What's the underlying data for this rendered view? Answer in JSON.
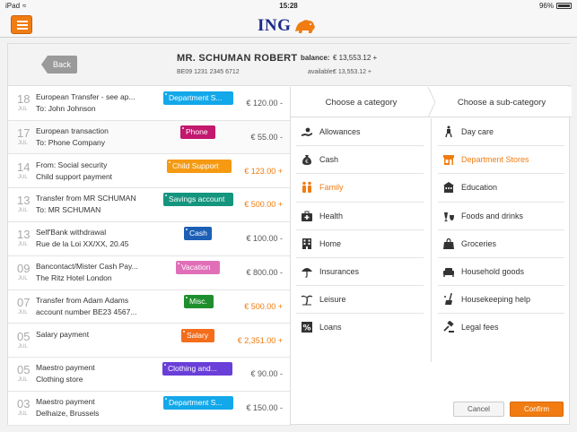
{
  "status": {
    "device": "iPad",
    "time": "15:28",
    "battery": "96%"
  },
  "brand": {
    "name": "ING",
    "accent": "#f07c12",
    "brand_blue": "#1a2a8a"
  },
  "header": {
    "back_label": "Back",
    "owner": "MR. SCHUMAN ROBERT",
    "iban": "BE09 1231 2345 6712",
    "balance_label": "balance:",
    "balance_value": "€ 13,553.12 +",
    "available_label": "available:",
    "available_value": "€ 13,553.12 +"
  },
  "transactions": [
    {
      "day": "18",
      "month": "JUL",
      "line1": "European Transfer - see ap...",
      "line2": "To: John Johnson",
      "tag": "Department S...",
      "tag_color": "#13a8ea",
      "amount": "€ 120.00 -",
      "positive": false
    },
    {
      "day": "17",
      "month": "JUL",
      "line1": "European transaction",
      "line2": "To: Phone Company",
      "tag": "Phone",
      "tag_color": "#c2186e",
      "amount": "€ 55.00 -",
      "positive": false
    },
    {
      "day": "14",
      "month": "JUL",
      "line1": "From: Social security",
      "line2": "Child support payment",
      "tag": "Child Support",
      "tag_color": "#f59a12",
      "amount": "€ 123.00 +",
      "positive": true
    },
    {
      "day": "13",
      "month": "JUL",
      "line1": "Transfer from MR SCHUMAN",
      "line2": "To: MR SCHUMAN",
      "tag": "Savings account",
      "tag_color": "#14957e",
      "amount": "€ 500.00 +",
      "positive": true
    },
    {
      "day": "13",
      "month": "JUL",
      "line1": "Self'Bank withdrawal",
      "line2": "Rue de la Loi XX/XX, 20.45",
      "tag": "Cash",
      "tag_color": "#1c5fb5",
      "amount": "€ 100.00 -",
      "positive": false
    },
    {
      "day": "09",
      "month": "JUL",
      "line1": "Bancontact/Mister Cash Pay...",
      "line2": "The Ritz Hotel London",
      "tag": "Vacation",
      "tag_color": "#e06fb8",
      "amount": "€ 800.00 -",
      "positive": false
    },
    {
      "day": "07",
      "month": "JUL",
      "line1": "Transfer from Adam Adams",
      "line2": "account number BE23 4567...",
      "tag": "Misc.",
      "tag_color": "#1f8f2e",
      "amount": "€ 500.00 +",
      "positive": true
    },
    {
      "day": "05",
      "month": "JUL",
      "line1": "Salary payment",
      "line2": "",
      "tag": "Salary",
      "tag_color": "#f36d1b",
      "amount": "€ 2,351.00 +",
      "positive": true
    },
    {
      "day": "05",
      "month": "JUL",
      "line1": "Maestro payment",
      "line2": "Clothing store",
      "tag": "Clothing and...",
      "tag_color": "#6a3ed8",
      "amount": "€ 90.00 -",
      "positive": false
    },
    {
      "day": "03",
      "month": "JUL",
      "line1": "Maestro payment",
      "line2": "Delhaize, Brussels",
      "tag": "Department S...",
      "tag_color": "#13a8ea",
      "amount": "€ 150.00 -",
      "positive": false
    }
  ],
  "panel": {
    "choose_category": "Choose a category",
    "choose_subcategory": "Choose a sub-category"
  },
  "categories": [
    {
      "label": "Allowances",
      "icon": "hand-coins-icon",
      "active": false
    },
    {
      "label": "Cash",
      "icon": "money-bag-icon",
      "active": false
    },
    {
      "label": "Family",
      "icon": "family-icon",
      "active": true
    },
    {
      "label": "Health",
      "icon": "medical-kit-icon",
      "active": false
    },
    {
      "label": "Home",
      "icon": "building-icon",
      "active": false
    },
    {
      "label": "Insurances",
      "icon": "umbrella-icon",
      "active": false
    },
    {
      "label": "Leisure",
      "icon": "palm-tree-icon",
      "active": false
    },
    {
      "label": "Loans",
      "icon": "percent-icon",
      "active": false
    }
  ],
  "subcategories": [
    {
      "label": "Day care",
      "icon": "stroller-icon",
      "active": false
    },
    {
      "label": "Department Stores",
      "icon": "storefront-icon",
      "active": true
    },
    {
      "label": "Education",
      "icon": "school-building-icon",
      "active": false
    },
    {
      "label": "Foods and drinks",
      "icon": "food-drink-icon",
      "active": false
    },
    {
      "label": "Groceries",
      "icon": "shopping-bag-icon",
      "active": false
    },
    {
      "label": "Household goods",
      "icon": "sofa-icon",
      "active": false
    },
    {
      "label": "Housekeeping help",
      "icon": "cleaning-icon",
      "active": false
    },
    {
      "label": "Legal fees",
      "icon": "gavel-icon",
      "active": false
    }
  ],
  "actions": {
    "cancel": "Cancel",
    "confirm": "Confirm"
  }
}
